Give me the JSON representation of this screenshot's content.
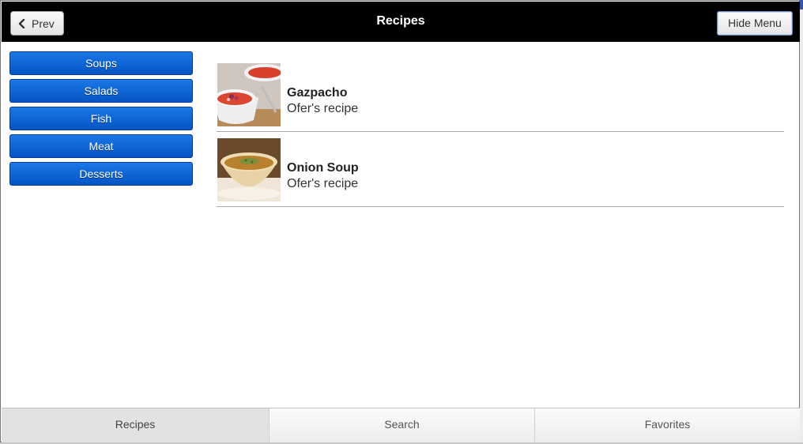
{
  "header": {
    "title": "Recipes",
    "prev_label": "Prev",
    "hide_menu_label": "Hide Menu"
  },
  "menu": {
    "items": [
      {
        "label": "Soups"
      },
      {
        "label": "Salads"
      },
      {
        "label": "Fish"
      },
      {
        "label": "Meat"
      },
      {
        "label": "Desserts"
      }
    ]
  },
  "recipes": [
    {
      "name": "Gazpacho",
      "subtitle": "Ofer's recipe",
      "image": "gazpacho-bowl-image"
    },
    {
      "name": "Onion Soup",
      "subtitle": "Ofer's recipe",
      "image": "onion-soup-bowl-image"
    }
  ],
  "tabs": [
    {
      "label": "Recipes",
      "active": true
    },
    {
      "label": "Search",
      "active": false
    },
    {
      "label": "Favorites",
      "active": false
    }
  ],
  "colors": {
    "header_bg": "#000000",
    "menu_button": "#0a62d4",
    "tab_active": "#e2e2e2"
  }
}
